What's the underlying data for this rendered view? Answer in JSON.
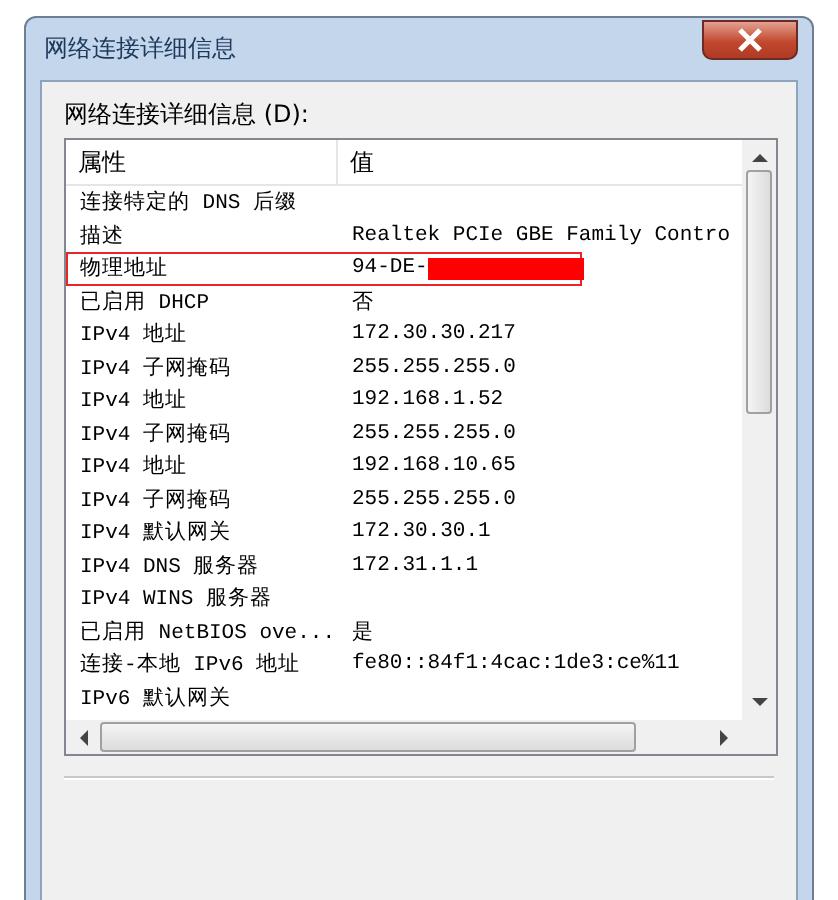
{
  "window": {
    "title": "网络连接详细信息"
  },
  "list_label": "网络连接详细信息 (D):",
  "table": {
    "columns": [
      "属性",
      "值"
    ],
    "rows": [
      {
        "property": "连接特定的 DNS 后缀",
        "value": "",
        "highlighted": false
      },
      {
        "property": "描述",
        "value": "Realtek PCIe GBE Family Contro",
        "highlighted": false
      },
      {
        "property": "物理地址",
        "value": "94-DE-",
        "redacted": true,
        "highlighted": true
      },
      {
        "property": "已启用 DHCP",
        "value": "否",
        "highlighted": false
      },
      {
        "property": "IPv4 地址",
        "value": "172.30.30.217",
        "highlighted": false
      },
      {
        "property": "IPv4 子网掩码",
        "value": "255.255.255.0",
        "highlighted": false
      },
      {
        "property": "IPv4 地址",
        "value": "192.168.1.52",
        "highlighted": false
      },
      {
        "property": "IPv4 子网掩码",
        "value": "255.255.255.0",
        "highlighted": false
      },
      {
        "property": "IPv4 地址",
        "value": "192.168.10.65",
        "highlighted": false
      },
      {
        "property": "IPv4 子网掩码",
        "value": "255.255.255.0",
        "highlighted": false
      },
      {
        "property": "IPv4 默认网关",
        "value": "172.30.30.1",
        "highlighted": false
      },
      {
        "property": "IPv4 DNS 服务器",
        "value": "172.31.1.1",
        "highlighted": false
      },
      {
        "property": "IPv4 WINS 服务器",
        "value": "",
        "highlighted": false
      },
      {
        "property": "已启用 NetBIOS ove...",
        "value": "是",
        "highlighted": false
      },
      {
        "property": "连接-本地 IPv6 地址",
        "value": "fe80::84f1:4cac:1de3:ce%11",
        "highlighted": false
      },
      {
        "property": "IPv6 默认网关",
        "value": "",
        "highlighted": false
      }
    ]
  }
}
